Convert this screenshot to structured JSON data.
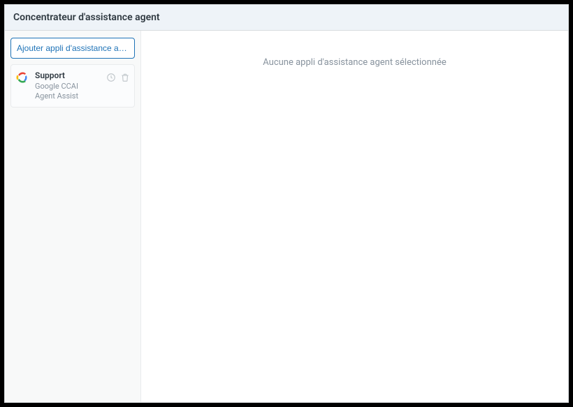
{
  "header": {
    "title": "Concentrateur d'assistance agent"
  },
  "sidebar": {
    "add_button_label": "Ajouter appli d'assistance ag...",
    "items": [
      {
        "title": "Support",
        "subtitle": "Google CCAI Agent Assist",
        "icon": "google-cloud-icon"
      }
    ]
  },
  "main": {
    "empty_message": "Aucune appli d'assistance agent sélectionnée"
  }
}
